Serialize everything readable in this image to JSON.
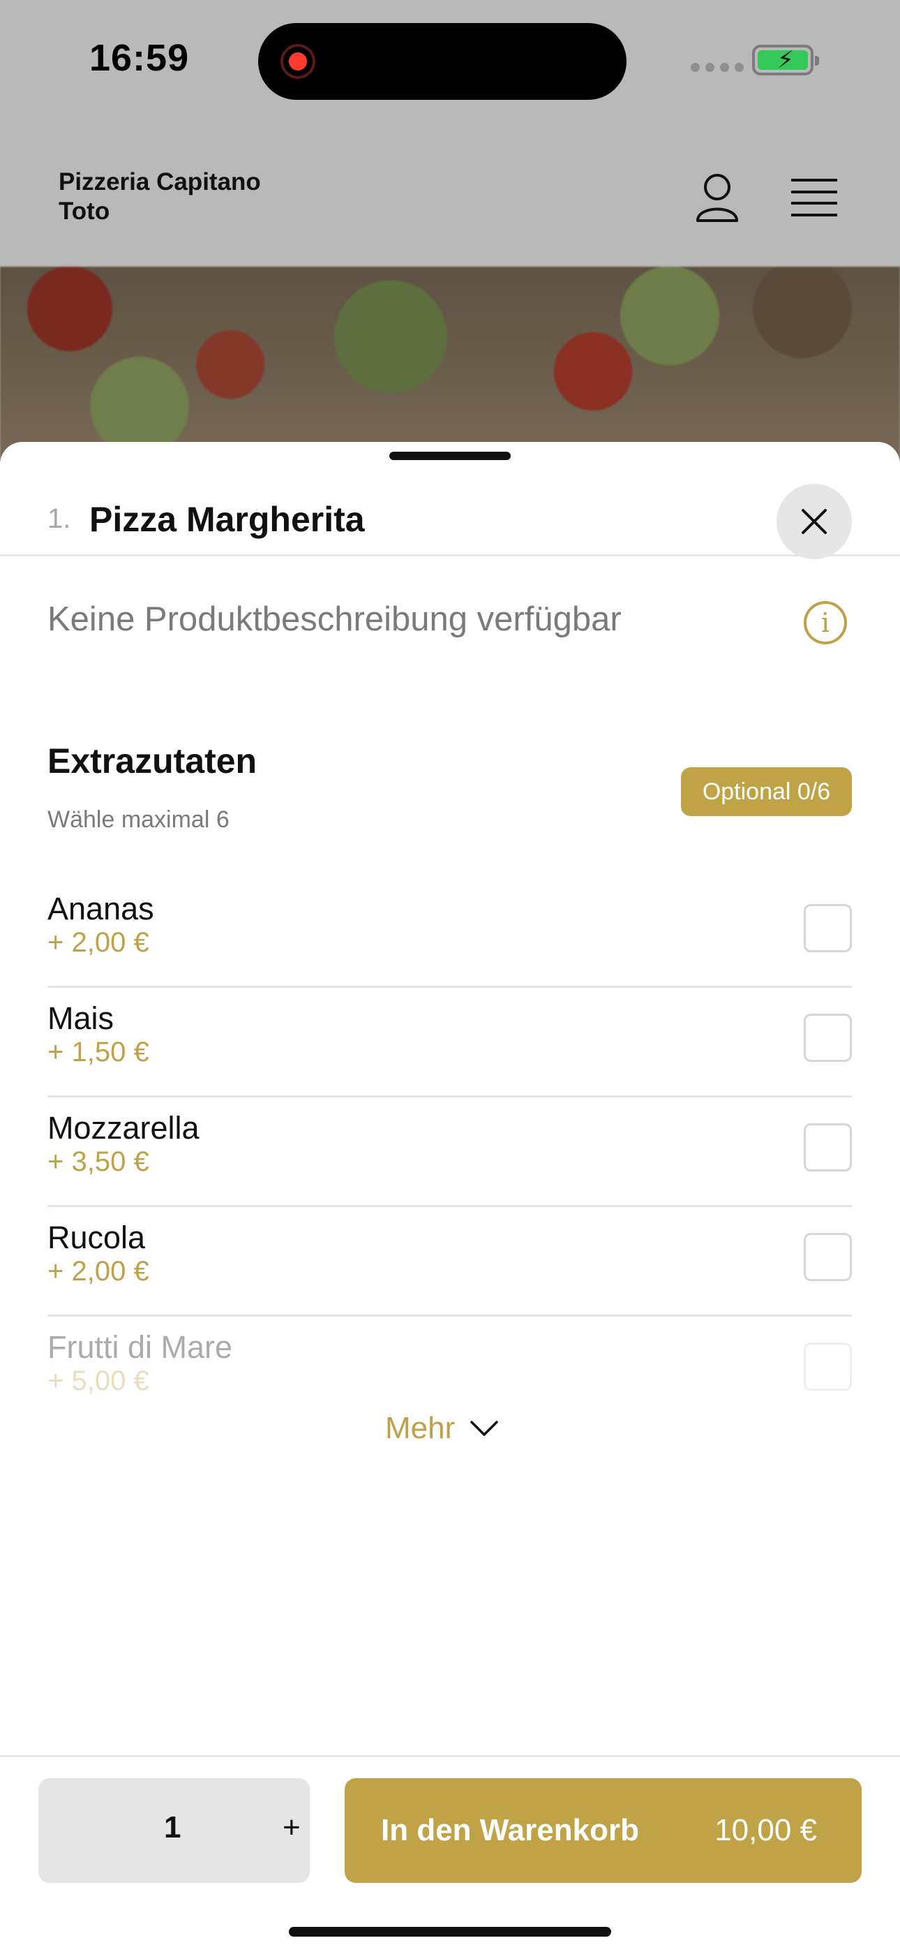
{
  "status_bar": {
    "time": "16:59"
  },
  "header": {
    "brand": "Pizzeria Capitano Toto"
  },
  "sheet": {
    "item_number": "1.",
    "item_title": "Pizza Margherita",
    "description": "Keine Produktbeschreibung verfügbar",
    "section": {
      "title": "Extrazutaten",
      "subtitle": "Wähle maximal 6",
      "badge": "Optional 0/6"
    },
    "options": [
      {
        "name": "Ananas",
        "price": "+ 2,00 €"
      },
      {
        "name": "Mais",
        "price": "+ 1,50 €"
      },
      {
        "name": "Mozzarella",
        "price": "+ 3,50 €"
      },
      {
        "name": "Rucola",
        "price": "+ 2,00 €"
      },
      {
        "name": "Frutti di Mare",
        "price": "+ 5,00 €"
      }
    ],
    "more_label": "Mehr"
  },
  "footer": {
    "quantity": "1",
    "plus": "+",
    "cart_label": "In den Warenkorb",
    "cart_price": "10,00 €"
  },
  "colors": {
    "accent": "#bfa346",
    "overlay": "#b9b9b9"
  }
}
